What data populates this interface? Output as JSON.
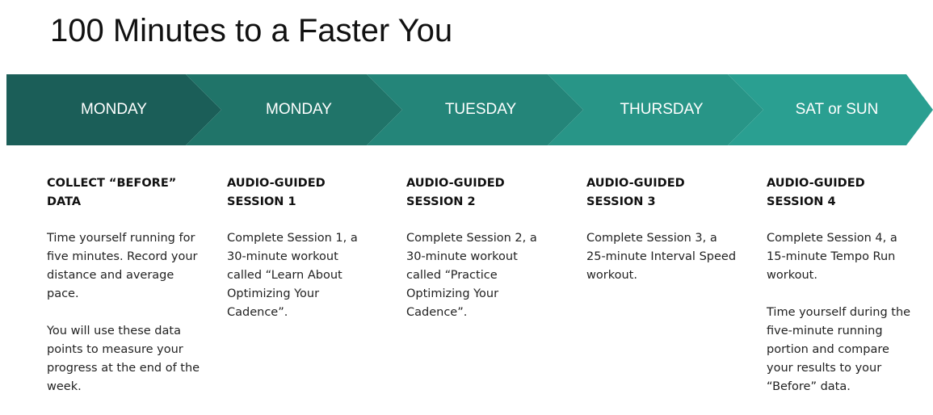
{
  "title": "100 Minutes to a Faster You",
  "colors": {
    "segment_1": "#1b5e58",
    "segment_2": "#207469",
    "segment_3": "#248579",
    "segment_4": "#289587",
    "segment_5": "#2a9f91",
    "label_text": "#ffffff"
  },
  "steps": [
    {
      "day": "MONDAY",
      "heading": "COLLECT “BEFORE” DATA",
      "paragraphs": [
        "Time yourself running for five minutes. Record your distance and average pace.",
        "You will use these data points to measure your progress at the end of the week."
      ]
    },
    {
      "day": "MONDAY",
      "heading": "AUDIO-GUIDED SESSION 1",
      "paragraphs": [
        "Complete Session 1, a 30-minute workout called “Learn About Optimizing Your Cadence”."
      ]
    },
    {
      "day": "TUESDAY",
      "heading": "AUDIO-GUIDED SESSION 2",
      "paragraphs": [
        "Complete Session 2, a 30-minute workout called “Practice Optimizing Your Cadence”."
      ]
    },
    {
      "day": "THURSDAY",
      "heading": "AUDIO-GUIDED SESSION 3",
      "paragraphs": [
        "Complete Session 3, a 25-minute Interval Speed workout."
      ]
    },
    {
      "day": "SAT or SUN",
      "heading": "AUDIO-GUIDED SESSION 4",
      "paragraphs": [
        "Complete Session 4, a 15-minute Tempo Run workout.",
        "Time yourself during the five-minute running portion and compare your results to your “Before” data."
      ]
    }
  ]
}
